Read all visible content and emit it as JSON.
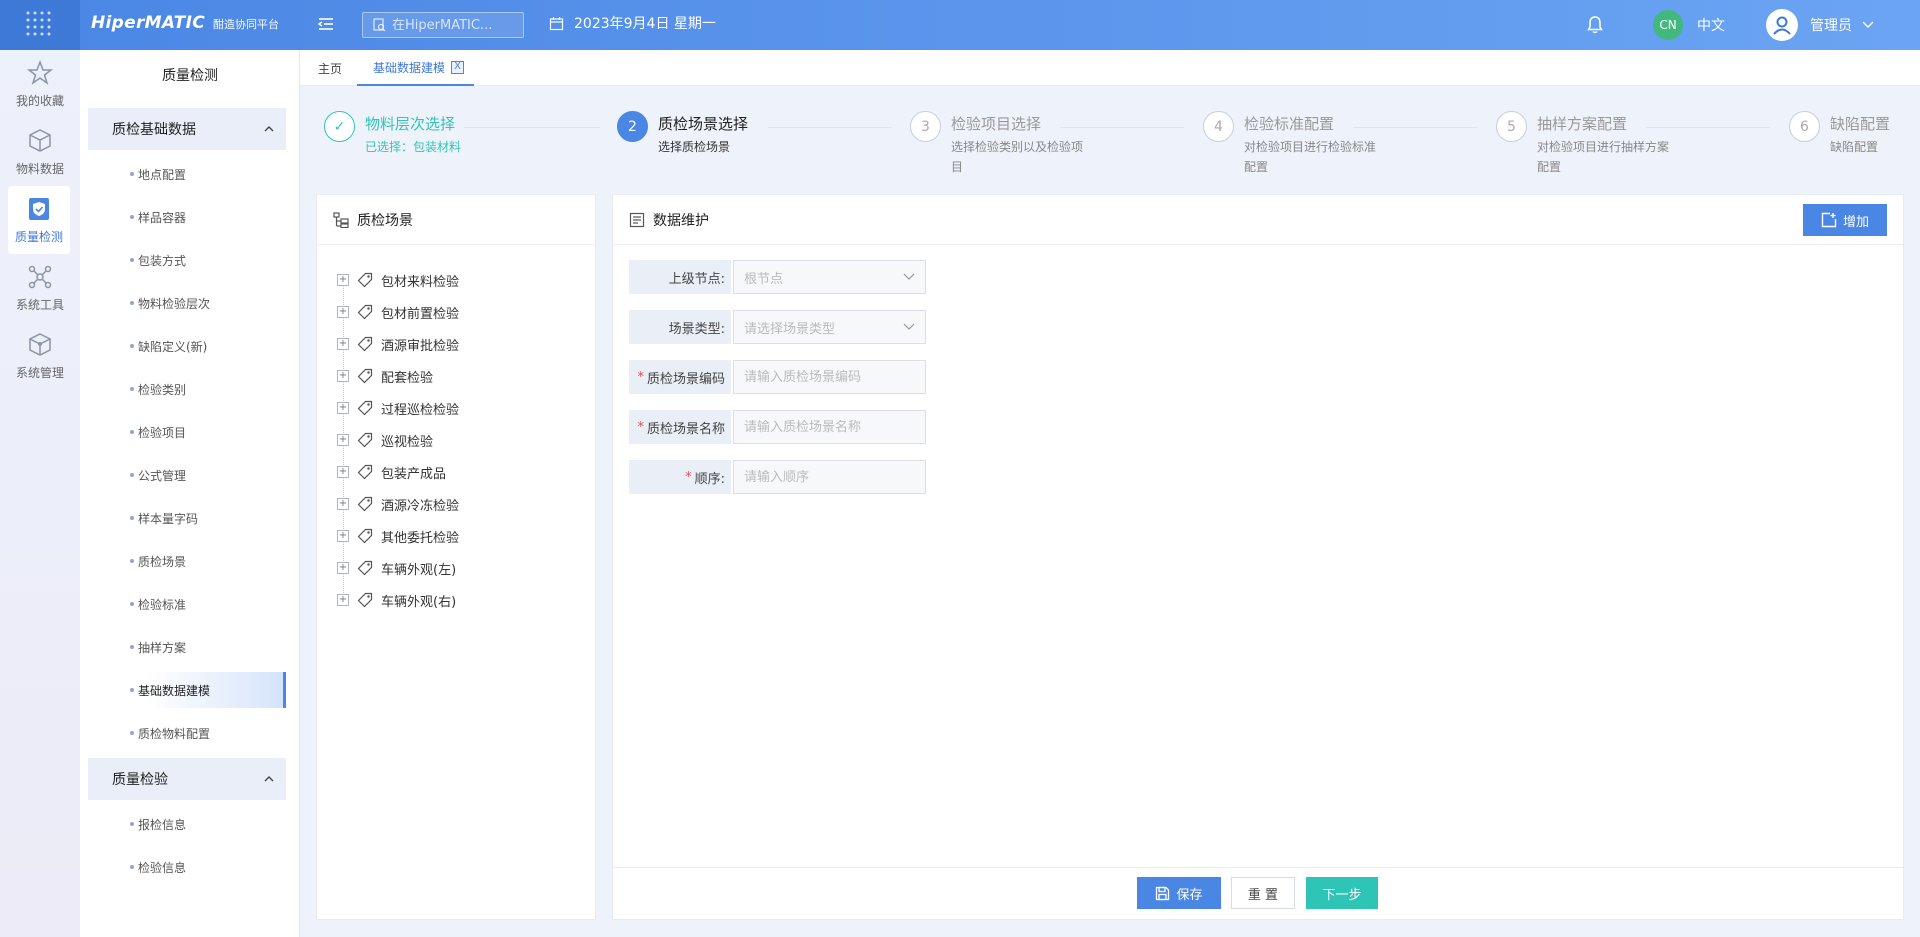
{
  "header": {
    "brand_name": "HiperMATIC",
    "brand_sub": "酣造协同平台",
    "search_placeholder": "在HiperMATIC...",
    "date": "2023年9月4日 星期一",
    "lang_badge": "CN",
    "lang_label": "中文",
    "user_name": "管理员"
  },
  "rail": {
    "items": [
      {
        "label": "我的收藏",
        "icon": "star-icon"
      },
      {
        "label": "物料数据",
        "icon": "box-icon"
      },
      {
        "label": "质量检测",
        "icon": "shield-icon"
      },
      {
        "label": "系统工具",
        "icon": "network-icon"
      },
      {
        "label": "系统管理",
        "icon": "cube-icon"
      }
    ]
  },
  "sidebar": {
    "title": "质量检测",
    "group1": "质检基础数据",
    "group1_items": [
      "地点配置",
      "样品容器",
      "包装方式",
      "物料检验层次",
      "缺陷定义(新)",
      "检验类别",
      "检验项目",
      "公式管理",
      "样本量字码",
      "质检场景",
      "检验标准",
      "抽样方案",
      "基础数据建模",
      "质检物料配置"
    ],
    "group2": "质量检验",
    "group2_items": [
      "报检信息",
      "检验信息"
    ]
  },
  "tabs": {
    "home": "主页",
    "active": "基础数据建模",
    "close": "X"
  },
  "steps": [
    {
      "num": "✓",
      "title": "物料层次选择",
      "desc": "已选择：包装材料",
      "state": "done"
    },
    {
      "num": "2",
      "title": "质检场景选择",
      "desc": "选择质检场景",
      "state": "current"
    },
    {
      "num": "3",
      "title": "检验项目选择",
      "desc": "选择检验类别以及检验项目",
      "state": "pending"
    },
    {
      "num": "4",
      "title": "检验标准配置",
      "desc": "对检验项目进行检验标准配置",
      "state": "pending"
    },
    {
      "num": "5",
      "title": "抽样方案配置",
      "desc": "对检验项目进行抽样方案配置",
      "state": "pending"
    },
    {
      "num": "6",
      "title": "缺陷配置",
      "desc": "缺陷配置",
      "state": "pending"
    }
  ],
  "tree": {
    "title": "质检场景",
    "expand_symbol": "+",
    "items": [
      "包材来料检验",
      "包材前置检验",
      "酒源审批检验",
      "配套检验",
      "过程巡检检验",
      "巡视检验",
      "包装产成品",
      "酒源冷冻检验",
      "其他委托检验",
      "车辆外观(左)",
      "车辆外观(右)"
    ]
  },
  "form": {
    "title": "数据维护",
    "add_label": "增加",
    "required_mark": "*",
    "fields": [
      {
        "label": "上级节点:",
        "required": false,
        "value": "根节点",
        "type": "select"
      },
      {
        "label": "场景类型:",
        "required": false,
        "value": "请选择场景类型",
        "type": "select"
      },
      {
        "label": "质检场景编码",
        "required": true,
        "placeholder": "请输入质检场景编码",
        "type": "input"
      },
      {
        "label": "质检场景名称",
        "required": true,
        "placeholder": "请输入质检场景名称",
        "type": "input"
      },
      {
        "label": "顺序:",
        "required": true,
        "placeholder": "请输入顺序",
        "type": "input"
      }
    ],
    "save_label": "保存",
    "reset_label": "重 置",
    "next_label": "下一步"
  },
  "colors": {
    "primary": "#4a86e4",
    "success": "#32c5b6",
    "next_button": "#2ec4b6",
    "required": "#e94b4b"
  }
}
